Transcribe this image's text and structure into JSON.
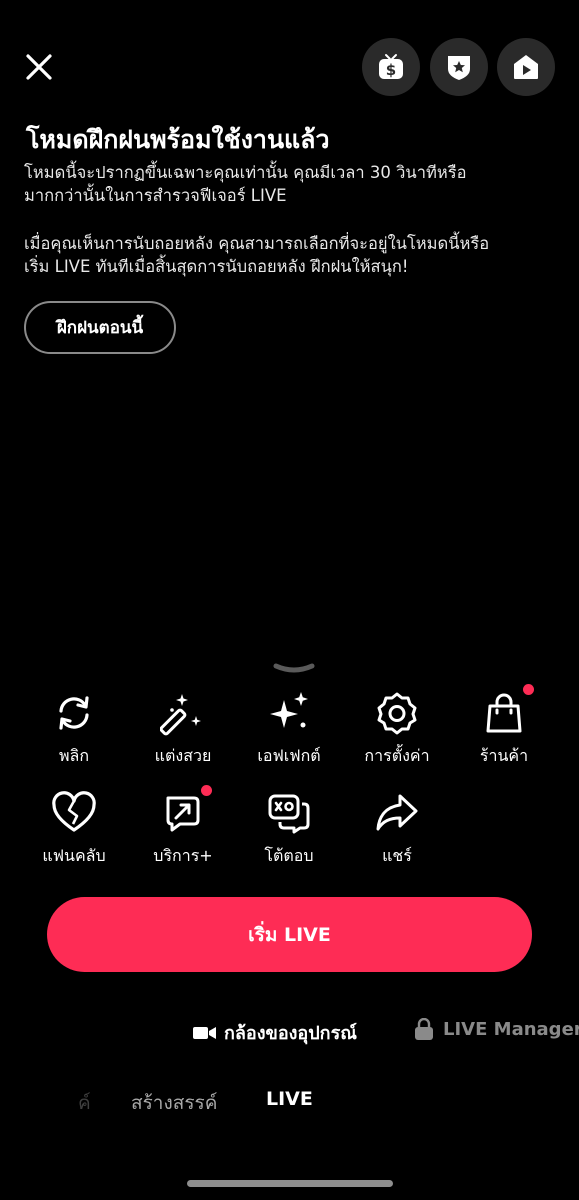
{
  "header": {
    "close_icon": "close-icon",
    "buttons": [
      {
        "name": "monetization-button",
        "icon": "dollar-tv-icon"
      },
      {
        "name": "rank-badge-button",
        "icon": "star-shield-icon"
      },
      {
        "name": "live-center-button",
        "icon": "home-play-icon"
      }
    ]
  },
  "intro": {
    "title": "โหมดฝึกฝนพร้อมใช้งานแล้ว",
    "paragraph1": [
      "โหมดนี้จะปรากฏขึ้นเฉพาะคุณเท่านั้น คุณมีเวลา 30 วินาทีหรือ",
      "มากกว่านั้นในการสำรวจฟีเจอร์ LIVE"
    ],
    "paragraph2": [
      "เมื่อคุณเห็นการนับถอยหลัง คุณสามารถเลือกที่จะอยู่ในโหมดนี้หรือ",
      "เริ่ม LIVE ทันทีเมื่อสิ้นสุดการนับถอยหลัง ฝึกฝนให้สนุก!"
    ],
    "practice_button": "ฝึกฝนตอนนี้"
  },
  "tools": {
    "row1": [
      {
        "label": "พลิก",
        "icon": "flip-camera-icon"
      },
      {
        "label": "แต่งสวย",
        "icon": "magic-wand-icon"
      },
      {
        "label": "เอฟเฟกต์",
        "icon": "sparkle-icon"
      },
      {
        "label": "การตั้งค่า",
        "icon": "settings-gear-icon"
      },
      {
        "label": "ร้านค้า",
        "icon": "shopping-bag-icon",
        "badge": true
      }
    ],
    "row2": [
      {
        "label": "แฟนคลับ",
        "icon": "heart-icon"
      },
      {
        "label": "บริการ+",
        "icon": "services-arrow-icon",
        "badge": true
      },
      {
        "label": "โต้ตอบ",
        "icon": "interact-icon"
      },
      {
        "label": "แชร์",
        "icon": "share-icon"
      }
    ]
  },
  "go_live_button": "เริ่ม LIVE",
  "sources": {
    "camera": "กล้องของอุปกรณ์",
    "live_manager": "LIVE Manager"
  },
  "modes": {
    "previous_partial": "ค์",
    "create": "สร้างสรรค์",
    "live": "LIVE"
  },
  "colors": {
    "accent": "#fe2c55",
    "background": "#000000",
    "circle_button": "#2a2a2a"
  }
}
